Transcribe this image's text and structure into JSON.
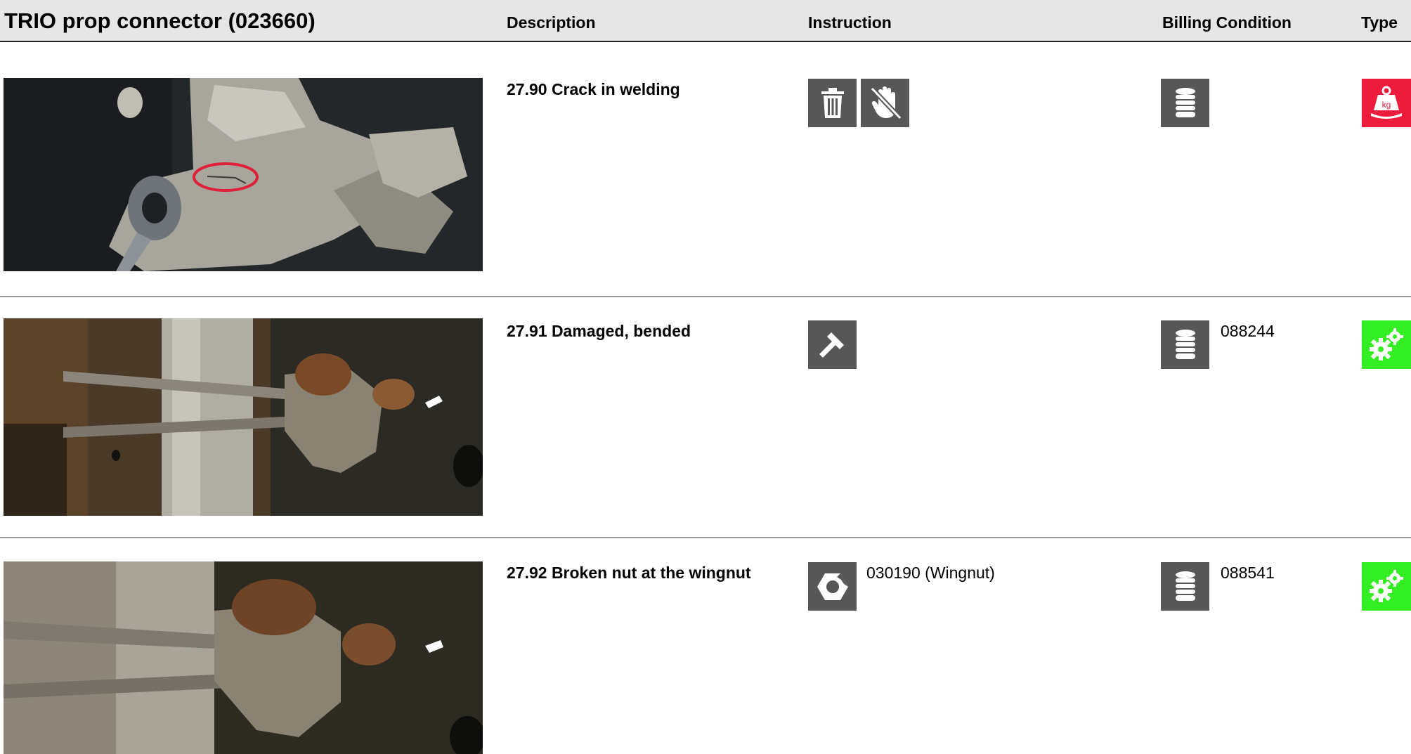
{
  "header": {
    "title": "TRIO prop connector (023660)",
    "col_description": "Description",
    "col_instruction": "Instruction",
    "col_billing": "Billing Condition",
    "col_type": "Type"
  },
  "rows": [
    {
      "description": "27.90 Crack in welding",
      "instruction_icons": [
        "trash-icon",
        "no-hand-icon"
      ],
      "instruction_text": "",
      "billing_icon": "coins-icon",
      "billing_value": "",
      "type_icon": "weight-kg-icon",
      "type_color": "#ee1c3c"
    },
    {
      "description": "27.91 Damaged, bended",
      "instruction_icons": [
        "hammer-icon"
      ],
      "instruction_text": "",
      "billing_icon": "coins-icon",
      "billing_value": "088244",
      "type_icon": "gears-icon",
      "type_color": "#33ee22"
    },
    {
      "description": "27.92 Broken nut at the wingnut",
      "instruction_icons": [
        "broken-nut-icon"
      ],
      "instruction_text": "030190 (Wingnut)",
      "billing_icon": "coins-icon",
      "billing_value": "088541",
      "type_icon": "gears-icon",
      "type_color": "#33ee22"
    }
  ]
}
